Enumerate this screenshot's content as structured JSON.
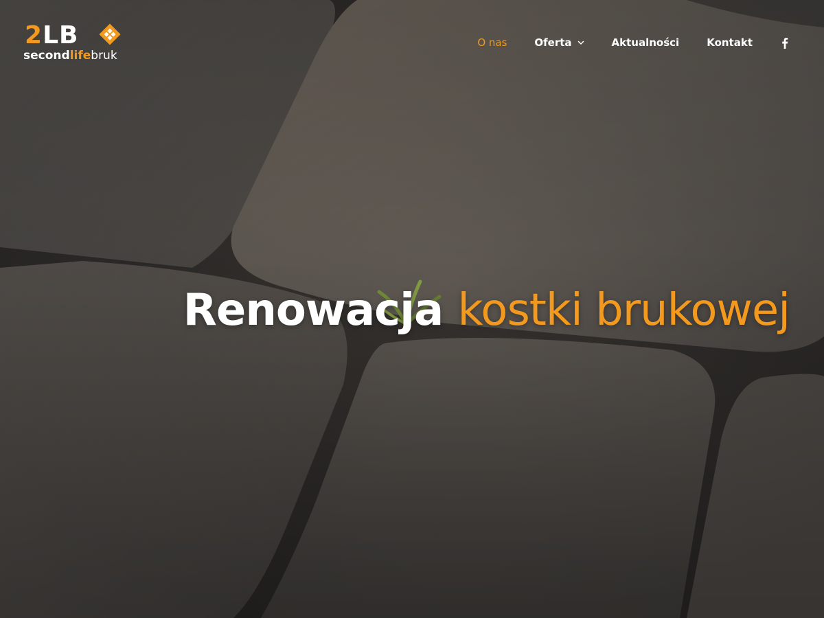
{
  "logo": {
    "mark_number": "2",
    "mark_letters": "LB",
    "word_second": "second",
    "word_life": "life",
    "word_bruk": "bruk"
  },
  "nav": {
    "items": [
      {
        "label": "O nas",
        "active": true
      },
      {
        "label": "Oferta",
        "has_dropdown": true
      },
      {
        "label": "Aktualności"
      },
      {
        "label": "Kontakt"
      }
    ],
    "social_icon": "facebook-icon"
  },
  "hero": {
    "heading_white": "Renowacja",
    "heading_orange": "kostki brukowej"
  },
  "colors": {
    "accent": "#f39a1e",
    "text": "#ffffff",
    "background": "#3d3b38"
  }
}
